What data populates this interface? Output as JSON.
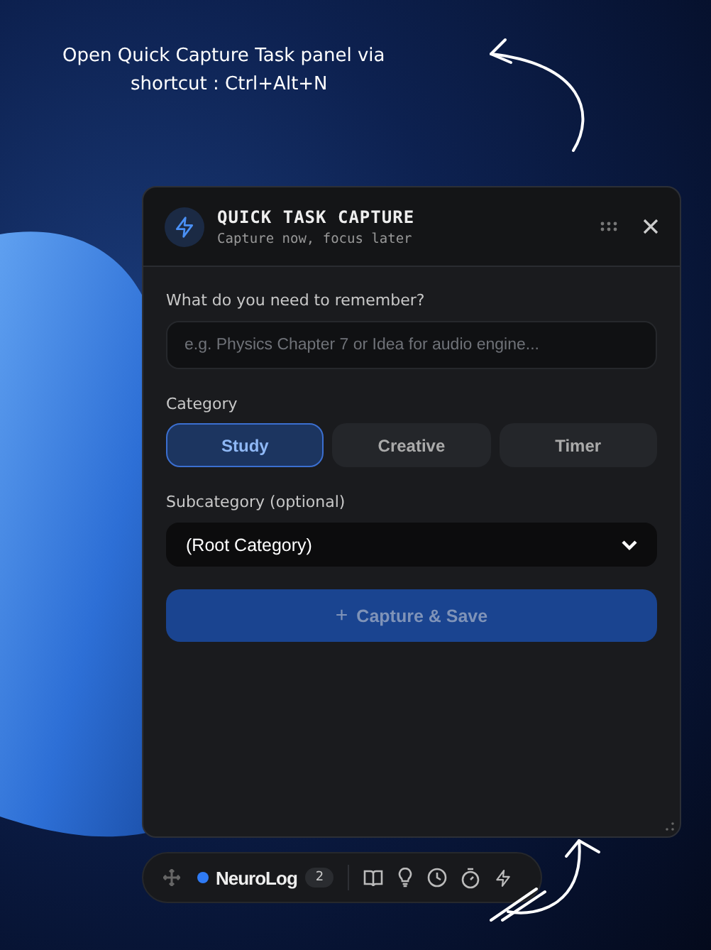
{
  "annotation": {
    "lines": [
      "Open Quick Capture Task panel via",
      "shortcut : Ctrl+Alt+N"
    ]
  },
  "panel": {
    "title": "QUICK TASK CAPTURE",
    "subtitle": "Capture now, focus later",
    "task_label": "What do you need to remember?",
    "task_placeholder": "e.g. Physics Chapter 7 or Idea for audio engine...",
    "category_label": "Category",
    "categories": [
      {
        "label": "Study",
        "selected": true
      },
      {
        "label": "Creative",
        "selected": false
      },
      {
        "label": "Timer",
        "selected": false
      }
    ],
    "subcategory_label": "Subcategory (optional)",
    "subcategory_value": "(Root Category)",
    "capture_button": {
      "icon": "+",
      "label": "Capture & Save"
    }
  },
  "dock": {
    "app_name": "NeuroLog",
    "count": "2"
  }
}
